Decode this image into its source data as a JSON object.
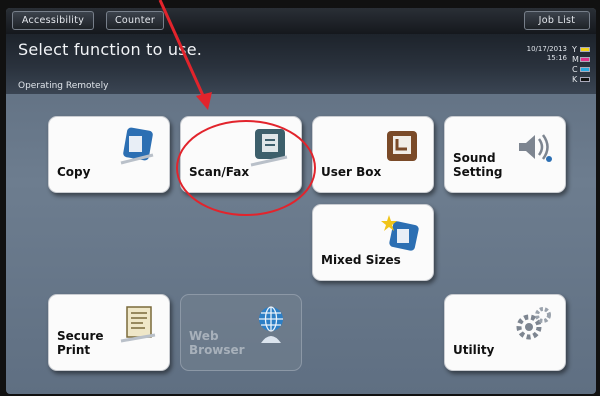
{
  "topbar": {
    "accessibility": "Accessibility",
    "counter": "Counter",
    "job_list": "Job List"
  },
  "header": {
    "title": "Select function to use.",
    "subtitle": "Operating Remotely",
    "date": "10/17/2013",
    "time": "15:16",
    "toner_labels": [
      "Y",
      "M",
      "C",
      "K"
    ]
  },
  "tiles": {
    "copy": "Copy",
    "scan_fax": "Scan/Fax",
    "user_box": "User Box",
    "sound_setting": "Sound\nSetting",
    "mixed_sizes": "Mixed Sizes",
    "secure_print": "Secure\nPrint",
    "web_browser": "Web\nBrowser",
    "utility": "Utility"
  },
  "colors": {
    "toner_yellow": "#f2d21b",
    "toner_magenta": "#e0338c",
    "toner_cyan": "#28a8e0",
    "toner_black": "#111111",
    "annotation_red": "#e2242c"
  }
}
